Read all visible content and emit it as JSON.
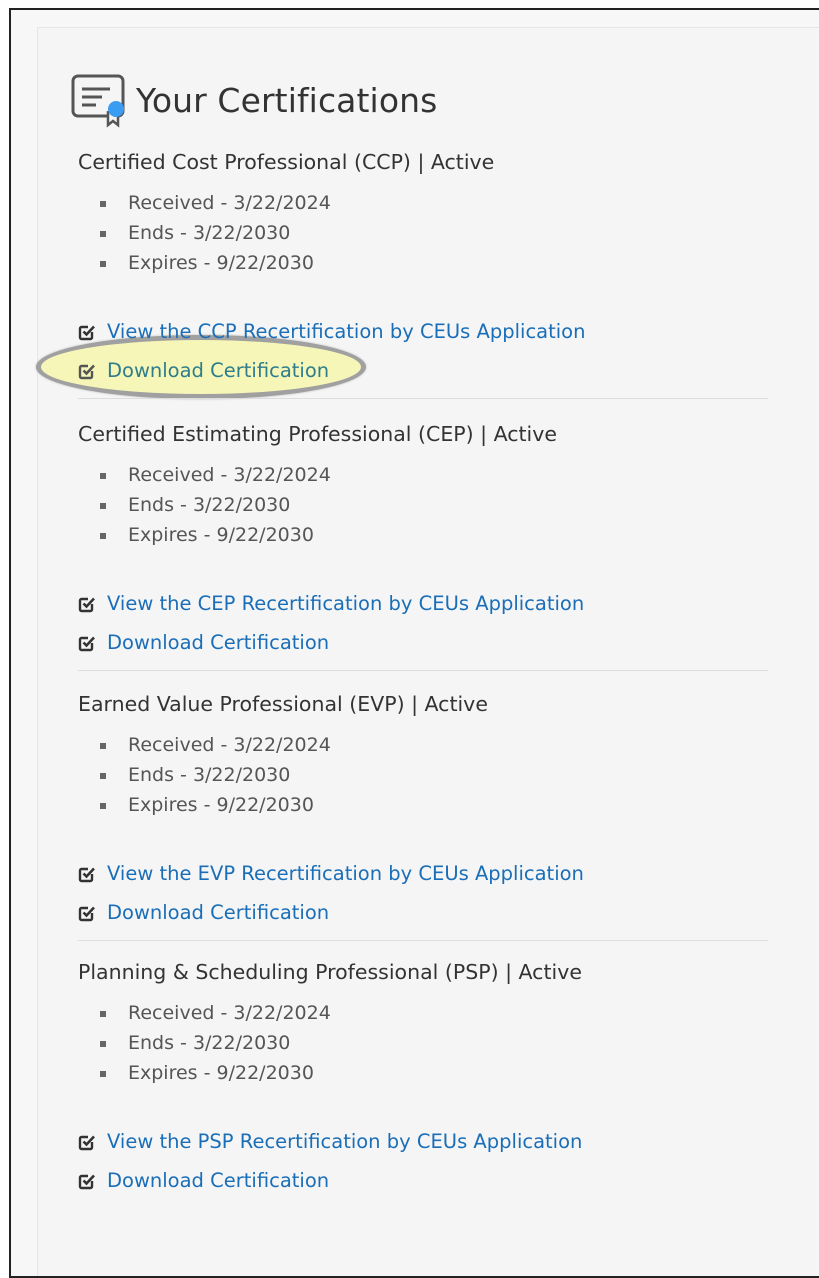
{
  "page": {
    "title": "Your Certifications",
    "icon": "certificate-icon"
  },
  "certifications": [
    {
      "name": "Certified Cost Professional (CCP) | Active",
      "received": "Received - 3/22/2024",
      "ends": "Ends - 3/22/2030",
      "expires": "Expires - 9/22/2030",
      "recert_link": "View the CCP Recertification by CEUs Application",
      "download_link": "Download Certification"
    },
    {
      "name": "Certified Estimating Professional (CEP) | Active",
      "received": "Received - 3/22/2024",
      "ends": "Ends - 3/22/2030",
      "expires": "Expires - 9/22/2030",
      "recert_link": "View the CEP Recertification by CEUs Application",
      "download_link": "Download Certification"
    },
    {
      "name": "Earned Value Professional (EVP) | Active",
      "received": "Received - 3/22/2024",
      "ends": "Ends - 3/22/2030",
      "expires": "Expires - 9/22/2030",
      "recert_link": "View the EVP Recertification by CEUs Application",
      "download_link": "Download Certification"
    },
    {
      "name": "Planning & Scheduling Professional (PSP) | Active",
      "received": "Received - 3/22/2024",
      "ends": "Ends - 3/22/2030",
      "expires": "Expires - 9/22/2030",
      "recert_link": "View the PSP Recertification by CEUs Application",
      "download_link": "Download Certification"
    }
  ],
  "colors": {
    "link": "#1a6eb8",
    "highlight_fill": "#f6f6b8",
    "highlight_ring": "#a0a0a0",
    "text": "#333333"
  }
}
